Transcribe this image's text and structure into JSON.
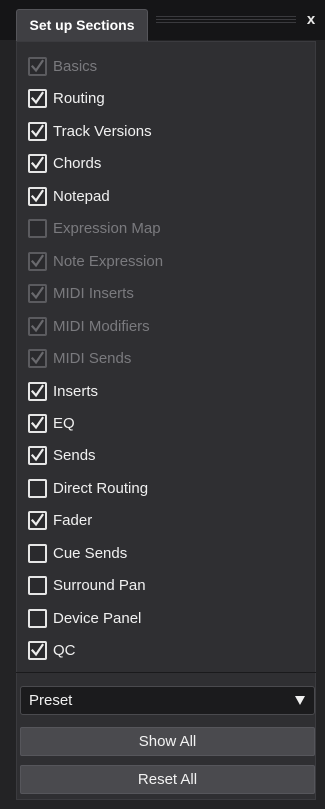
{
  "window": {
    "tab_title": "Set up Sections",
    "close_label": "x"
  },
  "sections": [
    {
      "label": "Basics",
      "checked": true,
      "enabled": false
    },
    {
      "label": "Routing",
      "checked": true,
      "enabled": true
    },
    {
      "label": "Track Versions",
      "checked": true,
      "enabled": true
    },
    {
      "label": "Chords",
      "checked": true,
      "enabled": true
    },
    {
      "label": "Notepad",
      "checked": true,
      "enabled": true
    },
    {
      "label": "Expression Map",
      "checked": false,
      "enabled": false
    },
    {
      "label": "Note Expression",
      "checked": true,
      "enabled": false
    },
    {
      "label": "MIDI Inserts",
      "checked": true,
      "enabled": false
    },
    {
      "label": "MIDI Modifiers",
      "checked": true,
      "enabled": false
    },
    {
      "label": "MIDI Sends",
      "checked": true,
      "enabled": false
    },
    {
      "label": "Inserts",
      "checked": true,
      "enabled": true
    },
    {
      "label": "EQ",
      "checked": true,
      "enabled": true
    },
    {
      "label": "Sends",
      "checked": true,
      "enabled": true
    },
    {
      "label": "Direct Routing",
      "checked": false,
      "enabled": true
    },
    {
      "label": "Fader",
      "checked": true,
      "enabled": true
    },
    {
      "label": "Cue Sends",
      "checked": false,
      "enabled": true
    },
    {
      "label": "Surround Pan",
      "checked": false,
      "enabled": true
    },
    {
      "label": "Device Panel",
      "checked": false,
      "enabled": true
    },
    {
      "label": "QC",
      "checked": true,
      "enabled": true
    }
  ],
  "preset": {
    "value": "Preset"
  },
  "buttons": {
    "show_all": "Show All",
    "reset_all": "Reset All"
  },
  "colors": {
    "background": "#232325",
    "panel": "#2f2f32",
    "check_enabled": "#e6e6e6",
    "check_disabled": "#5b5b5f",
    "text_disabled": "#7a7a7e"
  }
}
